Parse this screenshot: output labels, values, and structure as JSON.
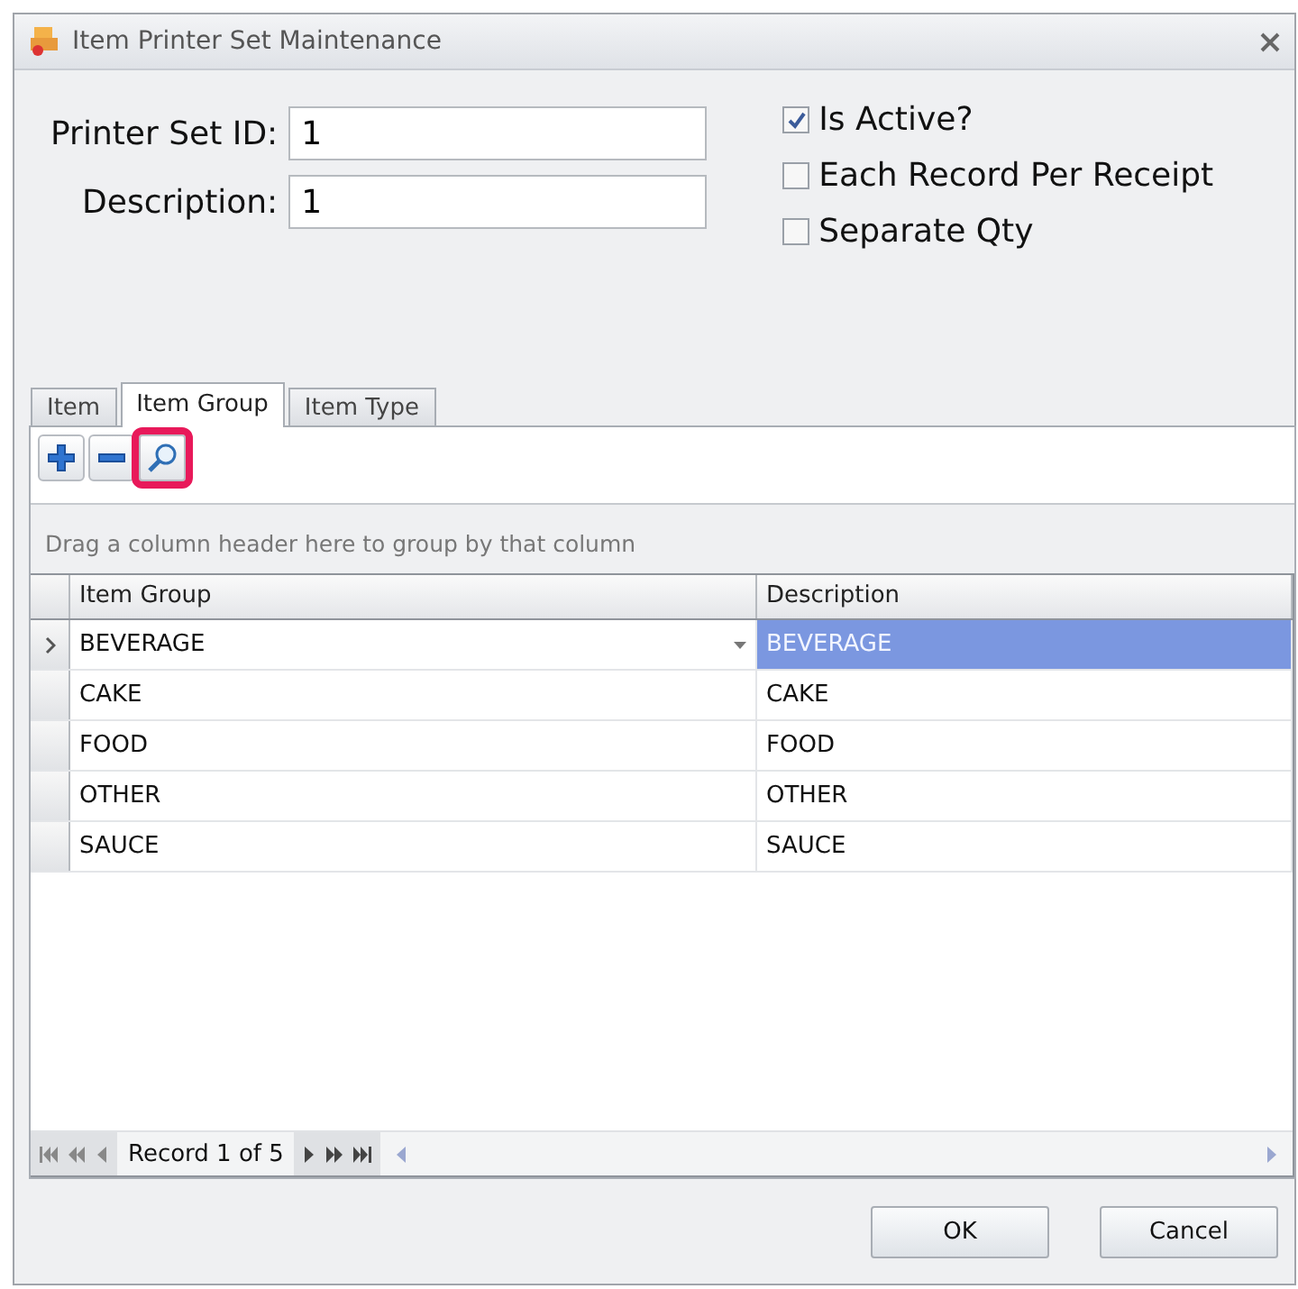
{
  "window": {
    "title": "Item Printer Set Maintenance"
  },
  "fields": [
    {
      "label": "Printer Set ID:",
      "value": "1"
    },
    {
      "label": "Description:",
      "value": "1"
    }
  ],
  "options": [
    {
      "label": "Is Active?",
      "checked": true
    },
    {
      "label": "Each Record Per Receipt",
      "checked": false
    },
    {
      "label": "Separate Qty",
      "checked": false
    }
  ],
  "tabs": [
    {
      "label": "Item",
      "selected": false
    },
    {
      "label": "Item Group",
      "selected": true
    },
    {
      "label": "Item Type",
      "selected": false
    }
  ],
  "toolbar": [
    {
      "kind": "add",
      "highlighted": false
    },
    {
      "kind": "remove",
      "highlighted": false
    },
    {
      "kind": "find",
      "highlighted": true
    }
  ],
  "group_panel": {
    "hint": "Drag a column header here to group by that column"
  },
  "table": {
    "columns": [
      "Item Group",
      "Description"
    ],
    "rows": [
      {
        "cells": [
          "BEVERAGE",
          "BEVERAGE"
        ],
        "selected": true
      },
      {
        "cells": [
          "CAKE",
          "CAKE"
        ],
        "selected": false
      },
      {
        "cells": [
          "FOOD",
          "FOOD"
        ],
        "selected": false
      },
      {
        "cells": [
          "OTHER",
          "OTHER"
        ],
        "selected": false
      },
      {
        "cells": [
          "SAUCE",
          "SAUCE"
        ],
        "selected": false
      }
    ]
  },
  "navigator": {
    "text": "Record 1 of 5"
  },
  "buttons": [
    "OK",
    "Cancel"
  ]
}
